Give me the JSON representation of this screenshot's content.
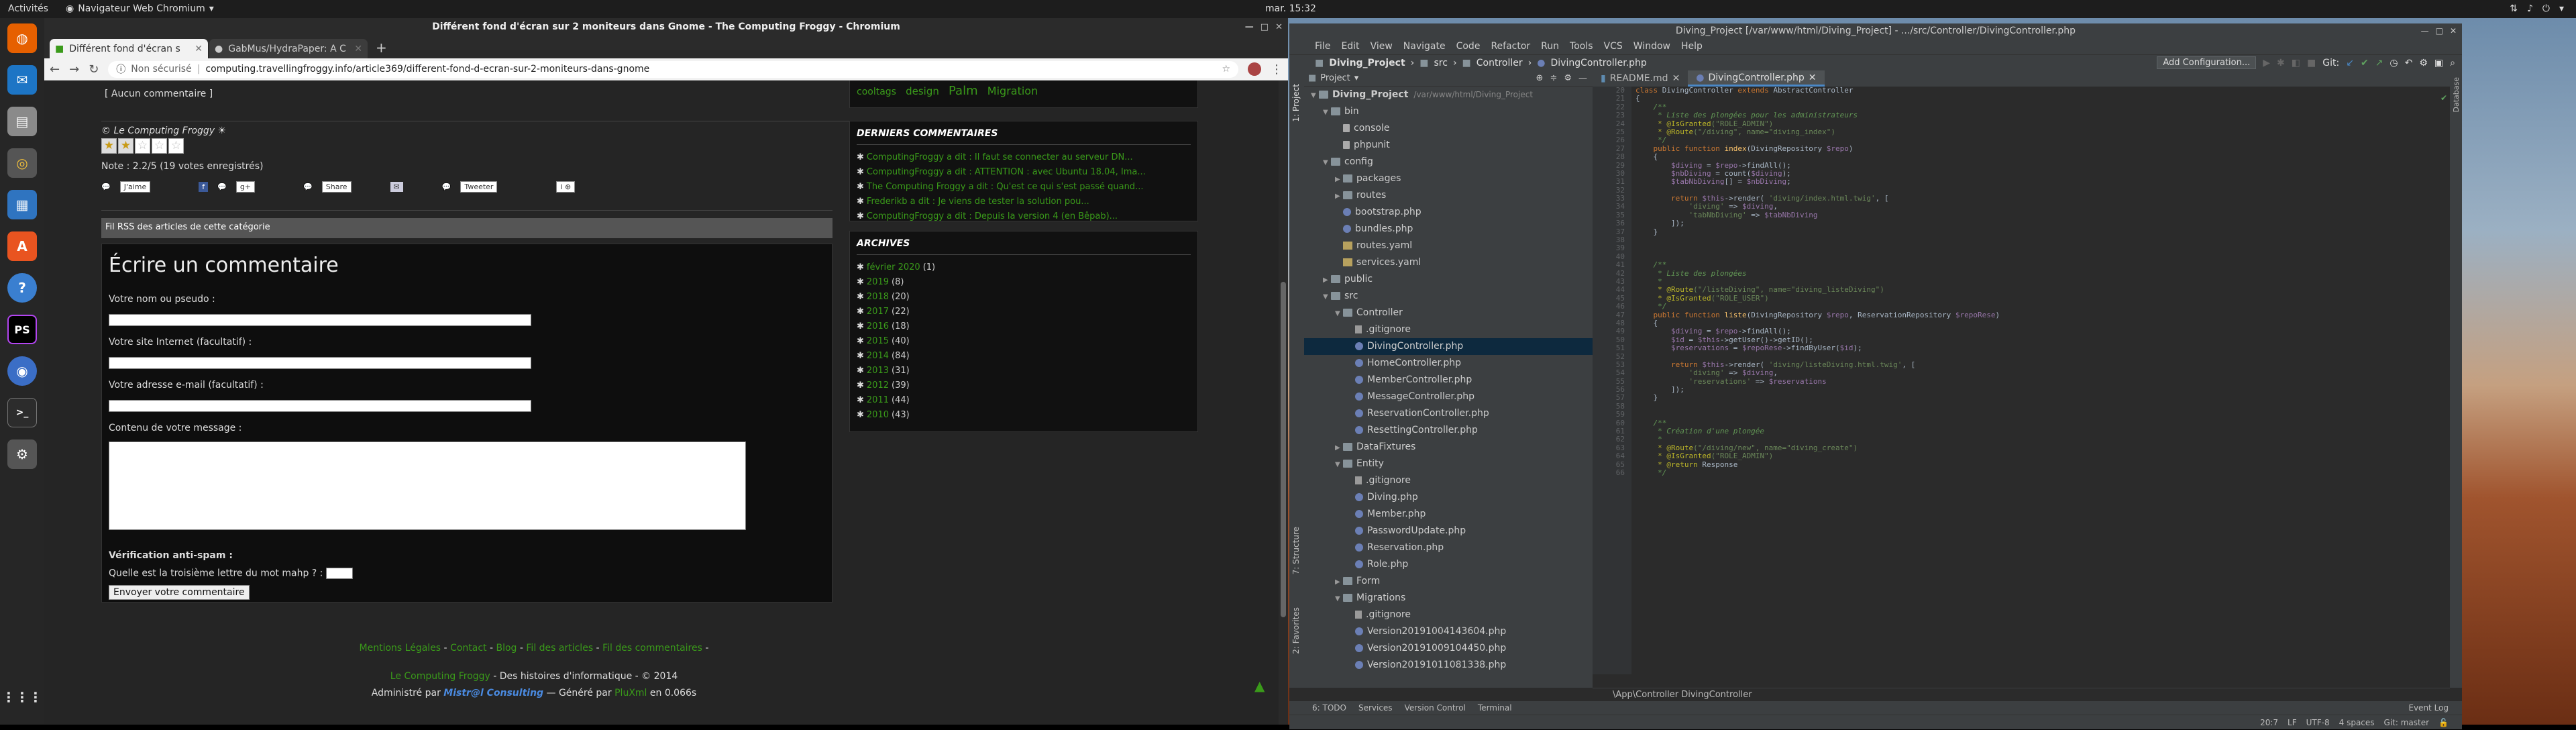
{
  "topbar": {
    "activities": "Activités",
    "app_menu": "Navigateur Web Chromium",
    "clock": "mar. 15:32"
  },
  "chromium": {
    "window_title": "Différent fond d'écran sur 2 moniteurs dans Gnome - The Computing Froggy - Chromium",
    "tabs": [
      {
        "label": "Différent fond d'écran s"
      },
      {
        "label": "GabMus/HydraPaper: A C"
      }
    ],
    "security": "Non sécurisé",
    "url": "computing.travellingfroggy.info/article369/different-fond-d-ecran-sur-2-moniteurs-dans-gnome"
  },
  "article": {
    "no_comment": "[ Aucun commentaire ]",
    "copyright": "© Le Computing Froggy",
    "rating": "Note : 2.2/5 (19 votes enregistrés)",
    "rating_value": 2.2,
    "share": {
      "like": "J'aime",
      "share": "Share",
      "tweet": "Tweeter"
    },
    "rss": "Fil RSS des articles de cette catégorie"
  },
  "form": {
    "title": "Écrire un commentaire",
    "name_label": "Votre nom ou pseudo :",
    "site_label": "Votre site Internet (facultatif) :",
    "email_label": "Votre adresse e-mail (facultatif) :",
    "message_label": "Contenu de votre message :",
    "antispam_title": "Vérification anti-spam :",
    "antispam_question": "Quelle est la troisième lettre du mot mahp ? :",
    "submit": "Envoyer votre commentaire"
  },
  "sidebar": {
    "tags": [
      "cooltags",
      "design",
      "Palm",
      "Migration"
    ],
    "comments_title": "DERNIERS COMMENTAIRES",
    "comments": [
      "ComputingFroggy a dit : Il faut se connecter au serveur DN...",
      "ComputingFroggy a dit : ATTENTION : avec Ubuntu 18.04, Ima...",
      "The Computing Froggy a dit : Qu'est ce qui s'est passé quand...",
      "Frederikb a dit : Je viens de tester la solution pou...",
      "ComputingFroggy a dit : Depuis la version 4 (en Bêpab)..."
    ],
    "archives_title": "ARCHIVES",
    "archives": [
      {
        "label": "février 2020",
        "count": "(1)"
      },
      {
        "label": "2019",
        "count": "(8)"
      },
      {
        "label": "2018",
        "count": "(20)"
      },
      {
        "label": "2017",
        "count": "(22)"
      },
      {
        "label": "2016",
        "count": "(18)"
      },
      {
        "label": "2015",
        "count": "(40)"
      },
      {
        "label": "2014",
        "count": "(84)"
      },
      {
        "label": "2013",
        "count": "(31)"
      },
      {
        "label": "2012",
        "count": "(39)"
      },
      {
        "label": "2011",
        "count": "(44)"
      },
      {
        "label": "2010",
        "count": "(43)"
      }
    ]
  },
  "footer": {
    "links": [
      "Mentions Légales",
      "Contact",
      "Blog",
      "Fil des articles",
      "Fil des commentaires"
    ],
    "site": "Le Computing Froggy",
    "tagline": " - Des histoires d'informatique - © 2014",
    "admin_prefix": "Administré par ",
    "admin": "Mistr@l Consulting",
    "generated": " — Généré par ",
    "engine": "PluXml",
    "time": " en 0.066s"
  },
  "ide": {
    "window_title": "Diving_Project [/var/www/html/Diving_Project] - .../src/Controller/DivingController.php",
    "menu": [
      "File",
      "Edit",
      "View",
      "Navigate",
      "Code",
      "Refactor",
      "Run",
      "Tools",
      "VCS",
      "Window",
      "Help"
    ],
    "breadcrumb": [
      "Diving_Project",
      "src",
      "Controller",
      "DivingController.php"
    ],
    "add_config": "Add Configuration...",
    "git": "Git:",
    "project_label": "Project",
    "side_tabs": [
      "1: Project",
      "7: Structure",
      "2: Favorites"
    ],
    "tree": [
      {
        "label": "Diving_Project",
        "extra": "/var/www/html/Diving_Project",
        "depth": 0,
        "type": "folder",
        "open": true
      },
      {
        "label": "bin",
        "depth": 1,
        "type": "folder",
        "open": true
      },
      {
        "label": "console",
        "depth": 2,
        "type": "file"
      },
      {
        "label": "phpunit",
        "depth": 2,
        "type": "file"
      },
      {
        "label": "config",
        "depth": 1,
        "type": "folder",
        "open": true
      },
      {
        "label": "packages",
        "depth": 2,
        "type": "folder",
        "open": false
      },
      {
        "label": "routes",
        "depth": 2,
        "type": "folder",
        "open": false
      },
      {
        "label": "bootstrap.php",
        "depth": 2,
        "type": "php"
      },
      {
        "label": "bundles.php",
        "depth": 2,
        "type": "php"
      },
      {
        "label": "routes.yaml",
        "depth": 2,
        "type": "yml"
      },
      {
        "label": "services.yaml",
        "depth": 2,
        "type": "yml"
      },
      {
        "label": "public",
        "depth": 1,
        "type": "folder",
        "open": false
      },
      {
        "label": "src",
        "depth": 1,
        "type": "folder",
        "open": true
      },
      {
        "label": "Controller",
        "depth": 2,
        "type": "folder",
        "open": true
      },
      {
        "label": ".gitignore",
        "depth": 3,
        "type": "git"
      },
      {
        "label": "DivingController.php",
        "depth": 3,
        "type": "php",
        "selected": true
      },
      {
        "label": "HomeController.php",
        "depth": 3,
        "type": "php"
      },
      {
        "label": "MemberController.php",
        "depth": 3,
        "type": "php"
      },
      {
        "label": "MessageController.php",
        "depth": 3,
        "type": "php"
      },
      {
        "label": "ReservationController.php",
        "depth": 3,
        "type": "php"
      },
      {
        "label": "ResettingController.php",
        "depth": 3,
        "type": "php"
      },
      {
        "label": "DataFixtures",
        "depth": 2,
        "type": "folder",
        "open": false
      },
      {
        "label": "Entity",
        "depth": 2,
        "type": "folder",
        "open": true
      },
      {
        "label": ".gitignore",
        "depth": 3,
        "type": "git"
      },
      {
        "label": "Diving.php",
        "depth": 3,
        "type": "php"
      },
      {
        "label": "Member.php",
        "depth": 3,
        "type": "php"
      },
      {
        "label": "PasswordUpdate.php",
        "depth": 3,
        "type": "php"
      },
      {
        "label": "Reservation.php",
        "depth": 3,
        "type": "php"
      },
      {
        "label": "Role.php",
        "depth": 3,
        "type": "php"
      },
      {
        "label": "Form",
        "depth": 2,
        "type": "folder",
        "open": false
      },
      {
        "label": "Migrations",
        "depth": 2,
        "type": "folder",
        "open": true
      },
      {
        "label": ".gitignore",
        "depth": 3,
        "type": "git"
      },
      {
        "label": "Version20191004143604.php",
        "depth": 3,
        "type": "php"
      },
      {
        "label": "Version20191009104450.php",
        "depth": 3,
        "type": "php"
      },
      {
        "label": "Version20191011081338.php",
        "depth": 3,
        "type": "php"
      }
    ],
    "tabs": [
      {
        "label": "README.md"
      },
      {
        "label": "DivingController.php",
        "active": true
      }
    ],
    "first_line": 20,
    "code": [
      [
        [
          "kw",
          "class "
        ],
        [
          "",
          "DivingController "
        ],
        [
          "kw",
          "extends "
        ],
        [
          "",
          "AbstractController"
        ]
      ],
      [
        [
          "",
          "{"
        ]
      ],
      [
        [
          "cm",
          "    /**"
        ]
      ],
      [
        [
          "cm",
          "     * Liste des plongées pour les administrateurs"
        ]
      ],
      [
        [
          "an",
          "     * @IsGranted"
        ],
        [
          "st",
          "(\"ROLE_ADMIN\")"
        ]
      ],
      [
        [
          "an",
          "     * @Route"
        ],
        [
          "st",
          "(\"/diving\", name=\"diving_index\")"
        ]
      ],
      [
        [
          "cm",
          "     */"
        ]
      ],
      [
        [
          "kw",
          "    public function "
        ],
        [
          "fn",
          "index"
        ],
        [
          "",
          "(DivingRepository "
        ],
        [
          "vr",
          "$repo"
        ],
        [
          "",
          ")"
        ]
      ],
      [
        [
          "",
          "    {"
        ]
      ],
      [
        [
          "vr",
          "        $diving"
        ],
        [
          "",
          " = "
        ],
        [
          "vr",
          "$repo"
        ],
        [
          "",
          "->findAll();"
        ]
      ],
      [
        [
          "vr",
          "        $nbDiving"
        ],
        [
          "",
          " = count("
        ],
        [
          "vr",
          "$diving"
        ],
        [
          "",
          ");"
        ]
      ],
      [
        [
          "vr",
          "        $tabNbDiving"
        ],
        [
          "",
          "[] = "
        ],
        [
          "vr",
          "$nbDiving"
        ],
        [
          "",
          ";"
        ]
      ],
      [
        [
          "",
          ""
        ]
      ],
      [
        [
          "kw",
          "        return "
        ],
        [
          "vr",
          "$this"
        ],
        [
          "",
          "->render( "
        ],
        [
          "st",
          "'diving/index.html.twig'"
        ],
        [
          "",
          ", ["
        ]
      ],
      [
        [
          "st",
          "            'diving'"
        ],
        [
          "",
          " => "
        ],
        [
          "vr",
          "$diving"
        ],
        [
          "",
          ","
        ]
      ],
      [
        [
          "st",
          "            'tabNbDiving'"
        ],
        [
          "",
          " => "
        ],
        [
          "vr",
          "$tabNbDiving"
        ]
      ],
      [
        [
          "",
          "        ]);"
        ]
      ],
      [
        [
          "",
          "    }"
        ]
      ],
      [
        [
          "",
          ""
        ]
      ],
      [
        [
          "",
          ""
        ]
      ],
      [
        [
          "",
          ""
        ]
      ],
      [
        [
          "cm",
          "    /**"
        ]
      ],
      [
        [
          "cm",
          "     * Liste des plongées"
        ]
      ],
      [
        [
          "cm",
          "     *"
        ]
      ],
      [
        [
          "an",
          "     * @Route"
        ],
        [
          "st",
          "(\"/listeDiving\", name=\"diving_listeDiving\")"
        ]
      ],
      [
        [
          "an",
          "     * @IsGranted"
        ],
        [
          "st",
          "(\"ROLE_USER\")"
        ]
      ],
      [
        [
          "cm",
          "     */"
        ]
      ],
      [
        [
          "kw",
          "    public function "
        ],
        [
          "fn",
          "liste"
        ],
        [
          "",
          "(DivingRepository "
        ],
        [
          "vr",
          "$repo"
        ],
        [
          "",
          ", ReservationRepository "
        ],
        [
          "vr",
          "$repoRese"
        ],
        [
          "",
          ")"
        ]
      ],
      [
        [
          "",
          "    {"
        ]
      ],
      [
        [
          "vr",
          "        $diving"
        ],
        [
          "",
          " = "
        ],
        [
          "vr",
          "$repo"
        ],
        [
          "",
          "->findAll();"
        ]
      ],
      [
        [
          "vr",
          "        $id"
        ],
        [
          "",
          " = "
        ],
        [
          "vr",
          "$this"
        ],
        [
          "",
          "->getUser()->getID();"
        ]
      ],
      [
        [
          "vr",
          "        $reservations"
        ],
        [
          "",
          " = "
        ],
        [
          "vr",
          "$repoRese"
        ],
        [
          "",
          "->findByUser("
        ],
        [
          "vr",
          "$id"
        ],
        [
          "",
          ");"
        ]
      ],
      [
        [
          "",
          ""
        ]
      ],
      [
        [
          "kw",
          "        return "
        ],
        [
          "vr",
          "$this"
        ],
        [
          "",
          "->render( "
        ],
        [
          "st",
          "'diving/listeDiving.html.twig'"
        ],
        [
          "",
          ", ["
        ]
      ],
      [
        [
          "st",
          "            'diving'"
        ],
        [
          "",
          " => "
        ],
        [
          "vr",
          "$diving"
        ],
        [
          "",
          ","
        ]
      ],
      [
        [
          "st",
          "            'reservations'"
        ],
        [
          "",
          " => "
        ],
        [
          "vr",
          "$reservations"
        ]
      ],
      [
        [
          "",
          "        ]);"
        ]
      ],
      [
        [
          "",
          "    }"
        ]
      ],
      [
        [
          "",
          ""
        ]
      ],
      [
        [
          "",
          ""
        ]
      ],
      [
        [
          "cm",
          "    /**"
        ]
      ],
      [
        [
          "cm",
          "     * Création d'une plongée"
        ]
      ],
      [
        [
          "cm",
          "     *"
        ]
      ],
      [
        [
          "an",
          "     * @Route"
        ],
        [
          "st",
          "(\"/diving/new\", name=\"diving_create\")"
        ]
      ],
      [
        [
          "an",
          "     * @IsGranted"
        ],
        [
          "st",
          "(\"ROLE_ADMIN\")"
        ]
      ],
      [
        [
          "an",
          "     * @return "
        ],
        [
          "",
          "Response"
        ]
      ],
      [
        [
          "cm",
          "     */"
        ]
      ]
    ],
    "code_breadcrumb": "\\App\\Controller    DivingController",
    "bottom_tabs": [
      "6: TODO",
      "Services",
      "Version Control",
      "Terminal"
    ],
    "status": {
      "position": "20:7",
      "line_sep": "LF",
      "encoding": "UTF-8",
      "indent": "4 spaces",
      "branch": "Git: master",
      "event_log": "Event Log"
    }
  }
}
